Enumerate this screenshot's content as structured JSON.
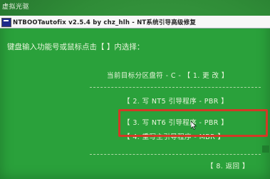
{
  "desktop": {
    "label": "虚拟光驱"
  },
  "window": {
    "title": "NTBOOTautofix v2.5.4 by chz_hlh - NT系统引导高级修复"
  },
  "prompt": "键盘输入功能号或鼠标点击【 】内选择：",
  "menu": {
    "current_partition": "当前目标分区盘符 - C - 【 1. 更  改 】",
    "item2": "【  2. 写 NT5 引导程序 - PBR    】",
    "item3": "【  3. 写 NT6 引导程序 - PBR    】",
    "item4": "【  4. 重写主引导程序 - MBR    】",
    "item8": "【 8. 返回 】"
  },
  "colors": {
    "background": "#2aa13b",
    "text": "#e9f5dc",
    "highlight": "#d13a26"
  }
}
